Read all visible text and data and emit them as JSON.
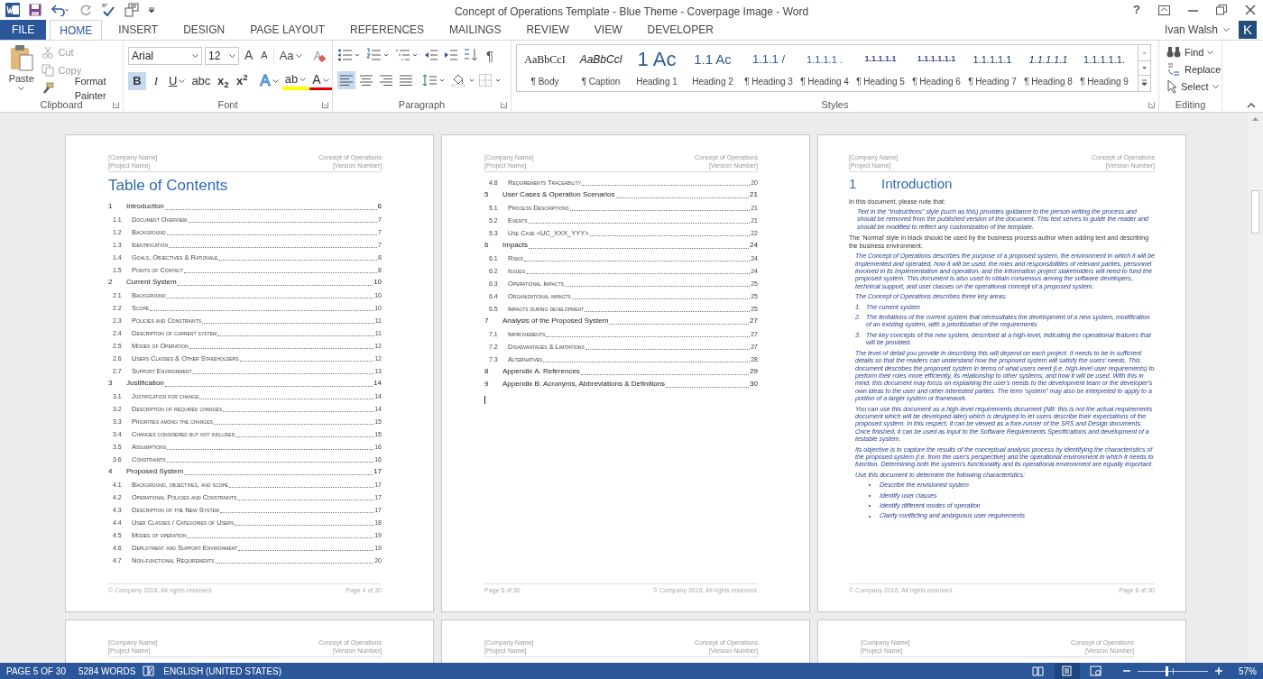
{
  "title_bar": {
    "title": "Concept of Operations Template - Blue Theme - Coverpage Image - Word",
    "help": "?"
  },
  "tabs": [
    {
      "label": "FILE",
      "kind": "file",
      "selected": false
    },
    {
      "label": "HOME",
      "kind": "tab",
      "selected": true
    },
    {
      "label": "INSERT",
      "kind": "tab",
      "selected": false
    },
    {
      "label": "DESIGN",
      "kind": "tab",
      "selected": false
    },
    {
      "label": "PAGE LAYOUT",
      "kind": "tab",
      "selected": false
    },
    {
      "label": "REFERENCES",
      "kind": "tab",
      "selected": false
    },
    {
      "label": "MAILINGS",
      "kind": "tab",
      "selected": false
    },
    {
      "label": "REVIEW",
      "kind": "tab",
      "selected": false
    },
    {
      "label": "VIEW",
      "kind": "tab",
      "selected": false
    },
    {
      "label": "DEVELOPER",
      "kind": "tab",
      "selected": false
    }
  ],
  "account": {
    "user": "Ivan Walsh",
    "avatar_letter": "K"
  },
  "clipboard": {
    "label": "Clipboard",
    "paste": "Paste",
    "cut": "Cut",
    "copy": "Copy",
    "format_painter": "Format Painter"
  },
  "font": {
    "label": "Font",
    "font_name": "Arial",
    "font_size": "12",
    "grow": "A",
    "shrink": "A",
    "change_case": "Aa",
    "buttons": [
      {
        "kind": "bold",
        "glyph": "B",
        "selected": true
      },
      {
        "kind": "italic",
        "glyph": "I",
        "selected": false
      },
      {
        "kind": "underline",
        "glyph": "U",
        "selected": false
      },
      {
        "kind": "strike",
        "glyph": "abc",
        "selected": false
      },
      {
        "kind": "sub",
        "glyph": "x$_{2}$",
        "selected": false
      },
      {
        "kind": "sup",
        "glyph": "x$^{2}$",
        "selected": false
      },
      {
        "kind": "effects",
        "glyph": "A",
        "selected": false
      },
      {
        "kind": "highlight",
        "glyph": "ab",
        "selected": false
      },
      {
        "kind": "color",
        "glyph": "A",
        "selected": false
      }
    ]
  },
  "paragraph": {
    "label": "Paragraph",
    "show_marks": {
      "glyph": "¶",
      "selected": false
    },
    "alignment": [
      {
        "kind": "left",
        "selected": true
      },
      {
        "kind": "center",
        "selected": false
      },
      {
        "kind": "right",
        "selected": false
      },
      {
        "kind": "justify",
        "selected": false
      }
    ]
  },
  "styles": {
    "label": "Styles",
    "items": [
      {
        "preview": "AaBbCcI",
        "label": "¶ Body",
        "kind": "serif"
      },
      {
        "preview": "AaBbCcl",
        "label": "¶ Caption",
        "kind": "italic"
      },
      {
        "preview": "1 Ac",
        "label": "Heading 1",
        "kind": "h1"
      },
      {
        "preview": "1.1 Ac",
        "label": "Heading 2",
        "kind": "h2"
      },
      {
        "preview": "1.1.1 /",
        "label": "¶ Heading 3",
        "kind": "h3"
      },
      {
        "preview": "1.1.1.1 .",
        "label": "¶ Heading 4",
        "kind": "h4"
      },
      {
        "preview": "1.1.1.1.1",
        "label": "¶ Heading 5",
        "kind": "small"
      },
      {
        "preview": "1.1.1.1.1.1",
        "label": "¶ Heading 6",
        "kind": "small"
      },
      {
        "preview": "1.1.1.1.1",
        "label": "¶ Heading 7",
        "kind": "dark"
      },
      {
        "preview": "1.1.1.1.1",
        "label": "¶ Heading 8",
        "kind": "dark_italic"
      },
      {
        "preview": "1.1.1.1.1.",
        "label": "¶ Heading 9",
        "kind": "dark"
      }
    ]
  },
  "editing": {
    "label": "Editing",
    "find": "Find",
    "replace": "Replace",
    "select": "Select"
  },
  "pages": [
    {
      "kind": "toc",
      "header": {
        "company": "[Company Name]",
        "project": "[Project Name]",
        "doc_title": "Concept of Operations",
        "version": "[Version Number]"
      },
      "title": "Table of Contents",
      "entries": [
        {
          "kind": "section",
          "num": "1",
          "text": "Introduction",
          "page": "6"
        },
        {
          "kind": "sub",
          "num": "1.1",
          "text": "Document Overview",
          "page": "7"
        },
        {
          "kind": "sub",
          "num": "1.2",
          "text": "Background",
          "page": "7"
        },
        {
          "kind": "sub",
          "num": "1.3",
          "text": "Identification",
          "page": "7"
        },
        {
          "kind": "sub",
          "num": "1.4",
          "text": "Goals, Objectives & Rationale",
          "page": "8"
        },
        {
          "kind": "sub",
          "num": "1.5",
          "text": "Points of Contact",
          "page": "8"
        },
        {
          "kind": "section",
          "num": "2",
          "text": "Current System",
          "page": "10"
        },
        {
          "kind": "sub",
          "num": "2.1",
          "text": "Background",
          "page": "10"
        },
        {
          "kind": "sub",
          "num": "2.2",
          "text": "Scope",
          "page": "10"
        },
        {
          "kind": "sub",
          "num": "2.3",
          "text": "Policies and Constraints",
          "page": "11"
        },
        {
          "kind": "sub",
          "num": "2.4",
          "text": "Description of current system",
          "page": "11"
        },
        {
          "kind": "sub",
          "num": "2.5",
          "text": "Modes of Operation",
          "page": "12"
        },
        {
          "kind": "sub",
          "num": "2.6",
          "text": "Users Classes & Other Stakeholders",
          "page": "12"
        },
        {
          "kind": "sub",
          "num": "2.7",
          "text": "Support Environment",
          "page": "13"
        },
        {
          "kind": "section",
          "num": "3",
          "text": "Justification",
          "page": "14"
        },
        {
          "kind": "sub",
          "num": "3.1",
          "text": "Justification for change",
          "page": "14"
        },
        {
          "kind": "sub",
          "num": "3.2",
          "text": "Description of required changes",
          "page": "14"
        },
        {
          "kind": "sub",
          "num": "3.3",
          "text": "Priorities among the changes",
          "page": "15"
        },
        {
          "kind": "sub",
          "num": "3.4",
          "text": "Changes considered but not included",
          "page": "15"
        },
        {
          "kind": "sub",
          "num": "3.5",
          "text": "Assumptions",
          "page": "16"
        },
        {
          "kind": "sub",
          "num": "3.6",
          "text": "Constraints",
          "page": "16"
        },
        {
          "kind": "section",
          "num": "4",
          "text": "Proposed System",
          "page": "17"
        },
        {
          "kind": "sub",
          "num": "4.1",
          "text": "Background, objectives, and scope",
          "page": "17"
        },
        {
          "kind": "sub",
          "num": "4.2",
          "text": "Operational Policies and Constraints",
          "page": "17"
        },
        {
          "kind": "sub",
          "num": "4.3",
          "text": "Description of the New System",
          "page": "17"
        },
        {
          "kind": "sub",
          "num": "4.4",
          "text": "User Classes / Categories of Users",
          "page": "18"
        },
        {
          "kind": "sub",
          "num": "4.5",
          "text": "Modes of operation",
          "page": "19"
        },
        {
          "kind": "sub",
          "num": "4.6",
          "text": "Deployment and Support Environment",
          "page": "19"
        },
        {
          "kind": "sub",
          "num": "4.7",
          "text": "Non-functional Requirements",
          "page": "20"
        }
      ],
      "footer": {
        "left": "© Company 2016. All rights reserved.",
        "right": "Page 4 of 30"
      }
    },
    {
      "kind": "toc",
      "header": {
        "company": "[Company Name]",
        "project": "[Project Name]",
        "doc_title": "Concept of Operations",
        "version": "[Version Number]"
      },
      "entries": [
        {
          "kind": "sub",
          "num": "4.8",
          "text": "Requirements Traceability",
          "page": "20"
        },
        {
          "kind": "section",
          "num": "5",
          "text": "User Cases & Operation Scenarios",
          "page": "21"
        },
        {
          "kind": "sub",
          "num": "5.1",
          "text": "Process Descriptions",
          "page": "21"
        },
        {
          "kind": "sub",
          "num": "5.2",
          "text": "Events",
          "page": "21"
        },
        {
          "kind": "sub",
          "num": "5.3",
          "text": "Use Case <UC_XXX_YYY>",
          "page": "22"
        },
        {
          "kind": "section",
          "num": "6",
          "text": "Impacts",
          "page": "24"
        },
        {
          "kind": "sub",
          "num": "6.1",
          "text": "Risks",
          "page": "24"
        },
        {
          "kind": "sub",
          "num": "6.2",
          "text": "Issues",
          "page": "24"
        },
        {
          "kind": "sub",
          "num": "6.3",
          "text": "Operational Impacts",
          "page": "25"
        },
        {
          "kind": "sub",
          "num": "6.4",
          "text": "Organizational impacts",
          "page": "25"
        },
        {
          "kind": "sub",
          "num": "6.5",
          "text": "Impacts during development",
          "page": "25"
        },
        {
          "kind": "section",
          "num": "7",
          "text": "Analysis of the Proposed System",
          "page": "27"
        },
        {
          "kind": "sub",
          "num": "7.1",
          "text": "Improvements",
          "page": "27"
        },
        {
          "kind": "sub",
          "num": "7.2",
          "text": "Disadvantages & Limitations",
          "page": "27"
        },
        {
          "kind": "sub",
          "num": "7.3",
          "text": "Alternatives",
          "page": "28"
        },
        {
          "kind": "section",
          "num": "8",
          "text": "Appendix A: References",
          "page": "29"
        },
        {
          "kind": "section",
          "num": "9",
          "text": "Appendix B: Acronyms, Abbreviations & Definitions",
          "page": "30"
        }
      ],
      "cursor": true,
      "footer": {
        "left": "Page 5 of 30",
        "right": "© Company 2016. All rights reserved."
      }
    },
    {
      "kind": "intro",
      "header": {
        "company": "[Company Name]",
        "project": "[Project Name]",
        "doc_title": "Concept of Operations",
        "version": "[Version Number]"
      },
      "heading_num": "1",
      "heading": "Introduction",
      "blocks": [
        {
          "kind": "normal",
          "text": "In this document, please note that:"
        },
        {
          "kind": "instruction_indent",
          "text": "Text in the “Instructions” style (such as this) provides guidance to the person writing the process and should be removed from the published version of the document. This text serves to guide the reader and should be modified to reflect any customization of the template."
        },
        {
          "kind": "normal",
          "text": "The ‘Normal’ style in black should be used by the business process author when adding text and describing the business environment."
        },
        {
          "kind": "instruction",
          "text": "The Concept of Operations describes the purpose of a proposed system, the environment in which it will be implemented and operated, how it will be used, the roles and responsibilities of relevant parties, personnel involved in its implementation and operation, and the information project stakeholders will need to fund the proposed system. This document is also used to obtain consensus among the software developers, technical support, and user classes on the operational concept of a proposed system."
        },
        {
          "kind": "instruction",
          "text": "The Concept of Operations describes three key areas:"
        },
        {
          "kind": "numbered",
          "items": [
            {
              "marker": "1.",
              "text": "The current system"
            },
            {
              "marker": "2.",
              "text": "The limitations of the current system that necessitates the development of a new system, modification of an existing system, with a prioritization of the requirements"
            },
            {
              "marker": "3.",
              "text": "The key concepts of the new system, described at a high-level, indicating the operational features that will be provided."
            }
          ]
        },
        {
          "kind": "instruction",
          "text": "The level of detail you provide in describing this will depend on each project. It needs to be in sufficient details so that the readers can understand how the proposed system will satisfy the users’ needs. This document describes the proposed system in terms of what users need (i.e. high-level user requirements) to perform their roles more efficiently, its relationship to other systems, and how it will be used. With this in mind, this document may focus on explaining the user's needs to the development team or the developer's own ideas to the user and other interested parties. The term ‘system” may also be interpreted to apply to a portion of a larger system or framework."
        },
        {
          "kind": "instruction",
          "text": "You can use this document as a high-level requirements document (NB: this is not the actual requirements document which will be developed later) which is designed to let users describe their expectations of the proposed system. In this respect, it can be viewed as a fore-runner of the SRS and Design documents. Once finished, it can be used as input to the Software Requirements Specifications and development of a testable system."
        },
        {
          "kind": "instruction",
          "text": "Its objective is to capture the results of the conceptual analysis process by identifying the characteristics of the proposed system (i.e. from the user's perspective) and the operational environment in which it needs to function. Determining both the system's functionality and its operational environment are equally important."
        },
        {
          "kind": "instruction",
          "text": "Use this document to determine the following characteristics:"
        },
        {
          "kind": "bullets",
          "items": [
            {
              "text": "Describe the envisioned system"
            },
            {
              "text": "Identify user classes"
            },
            {
              "text": "Identify different modes of operation"
            },
            {
              "text": "Clarify conflicting and ambiguous user requirements"
            }
          ]
        }
      ],
      "footer": {
        "left": "© Company 2016. All rights reserved.",
        "right": "Page 6 of 30"
      }
    },
    {
      "kind": "header_only",
      "header": {
        "company": "[Company Name]",
        "project": "[Project Name]",
        "doc_title": "Concept of Operations",
        "version": "[Version Number]"
      }
    },
    {
      "kind": "header_only",
      "header": {
        "company": "[Company Name]",
        "project": "[Project Name]",
        "doc_title": "Concept of Operations",
        "version": "[Version Number]"
      }
    },
    {
      "kind": "header_only",
      "header": {
        "company": "[Company Name]",
        "project": "[Project Name]",
        "doc_title": "Concept of Operations",
        "version": "[Version Number]"
      }
    }
  ],
  "status_bar": {
    "page": "PAGE 5 OF 30",
    "words": "5284 WORDS",
    "language": "ENGLISH (UNITED STATES)",
    "zoom": "57%",
    "zoom_level": {
      "level": 0.4
    },
    "views": [
      {
        "kind": "read",
        "selected": false
      },
      {
        "kind": "print",
        "selected": true
      },
      {
        "kind": "web",
        "selected": false
      }
    ]
  }
}
